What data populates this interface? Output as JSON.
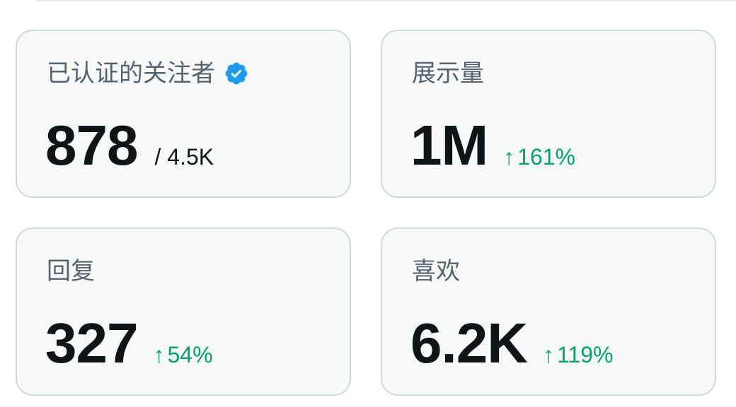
{
  "cards": [
    {
      "label": "已认证的关注者",
      "value": "878",
      "sub_total": "/ 4.5K",
      "verified": true
    },
    {
      "label": "展示量",
      "value": "1M",
      "trend_arrow": "↑",
      "trend": "161%"
    },
    {
      "label": "回复",
      "value": "327",
      "trend_arrow": "↑",
      "trend": "54%"
    },
    {
      "label": "喜欢",
      "value": "6.2K",
      "trend_arrow": "↑",
      "trend": "119%"
    }
  ],
  "colors": {
    "card_bg": "#f7f9f9",
    "card_border": "#cfd9de",
    "label": "#536471",
    "value": "#0f1419",
    "trend_up": "#00a36c",
    "verified_blue": "#1d9bf0"
  },
  "icons": {
    "verified": "verified-badge-icon",
    "trend": "arrow-up-icon"
  }
}
